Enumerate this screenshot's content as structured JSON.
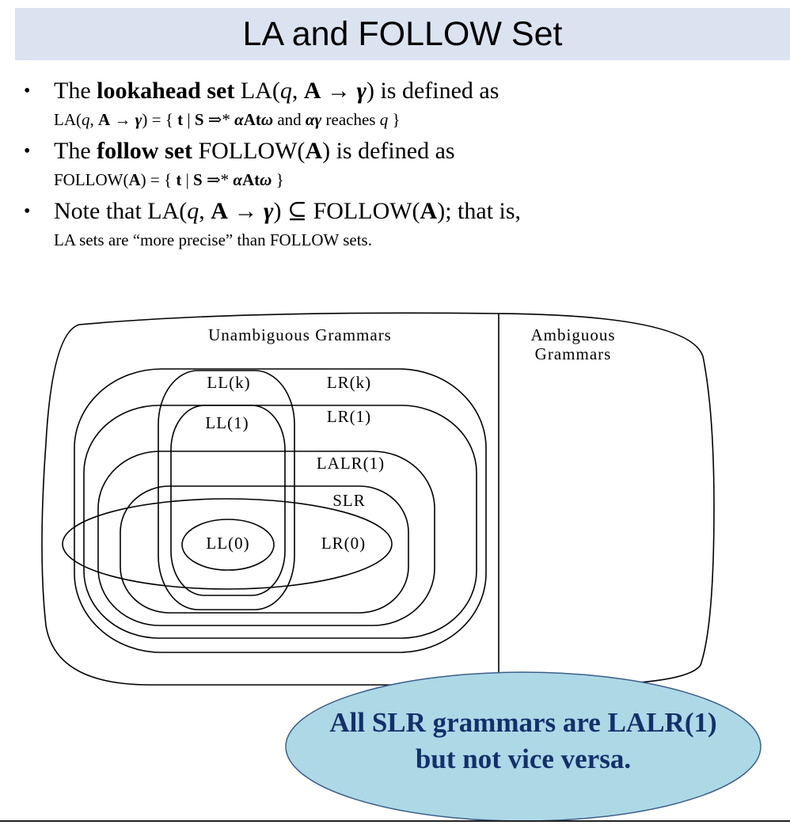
{
  "slide": {
    "title": "LA and FOLLOW Set"
  },
  "bullets": [
    {
      "main": [
        "The ",
        {
          "b": "lookahead set"
        },
        " LA(",
        {
          "i": "q"
        },
        ", ",
        {
          "b": "A"
        },
        " → ",
        {
          "bi": "γ"
        },
        ") is defined as"
      ],
      "sub": [
        "LA(",
        {
          "i": "q"
        },
        ", ",
        {
          "b": "A"
        },
        " → ",
        {
          "bi": "γ"
        },
        ") = { ",
        {
          "b": "t"
        },
        " | ",
        {
          "b": "S"
        },
        " ⇒* ",
        {
          "bi": "α"
        },
        {
          "b": "A"
        },
        {
          "b": "t"
        },
        {
          "bi": "ω"
        },
        " and ",
        {
          "bi": "αγ"
        },
        " reaches ",
        {
          "i": "q"
        },
        " }"
      ]
    },
    {
      "main": [
        "The ",
        {
          "b": "follow set"
        },
        " FOLLOW(",
        {
          "b": "A"
        },
        ") is defined as"
      ],
      "sub": [
        "FOLLOW(",
        {
          "b": "A"
        },
        ") = { ",
        {
          "b": "t"
        },
        " | ",
        {
          "b": "S"
        },
        " ⇒* ",
        {
          "bi": "α"
        },
        {
          "b": "A"
        },
        {
          "b": "t"
        },
        {
          "bi": "ω"
        },
        " }"
      ]
    },
    {
      "main": [
        "Note that LA(",
        {
          "i": "q"
        },
        ", ",
        {
          "b": "A"
        },
        " → ",
        {
          "bi": "γ"
        },
        ") ⊆ FOLLOW(",
        {
          "b": "A"
        },
        "); that is,"
      ],
      "sub": [
        "LA sets are “more precise” than FOLLOW sets."
      ]
    }
  ],
  "diagram": {
    "unambiguous_label": "Unambiguous Grammars",
    "ambiguous_label_line1": "Ambiguous",
    "ambiguous_label_line2": "Grammars",
    "sets": {
      "llk": "LL(k)",
      "lrk": "LR(k)",
      "ll1": "LL(1)",
      "lr1": "LR(1)",
      "lalr1": "LALR(1)",
      "slr": "SLR",
      "ll0": "LL(0)",
      "lr0": "LR(0)"
    }
  },
  "callout": {
    "line1": "All SLR grammars are LALR(1)",
    "line2": "but not vice versa.",
    "fill": "#add8e6",
    "text_color": "#13306b"
  }
}
